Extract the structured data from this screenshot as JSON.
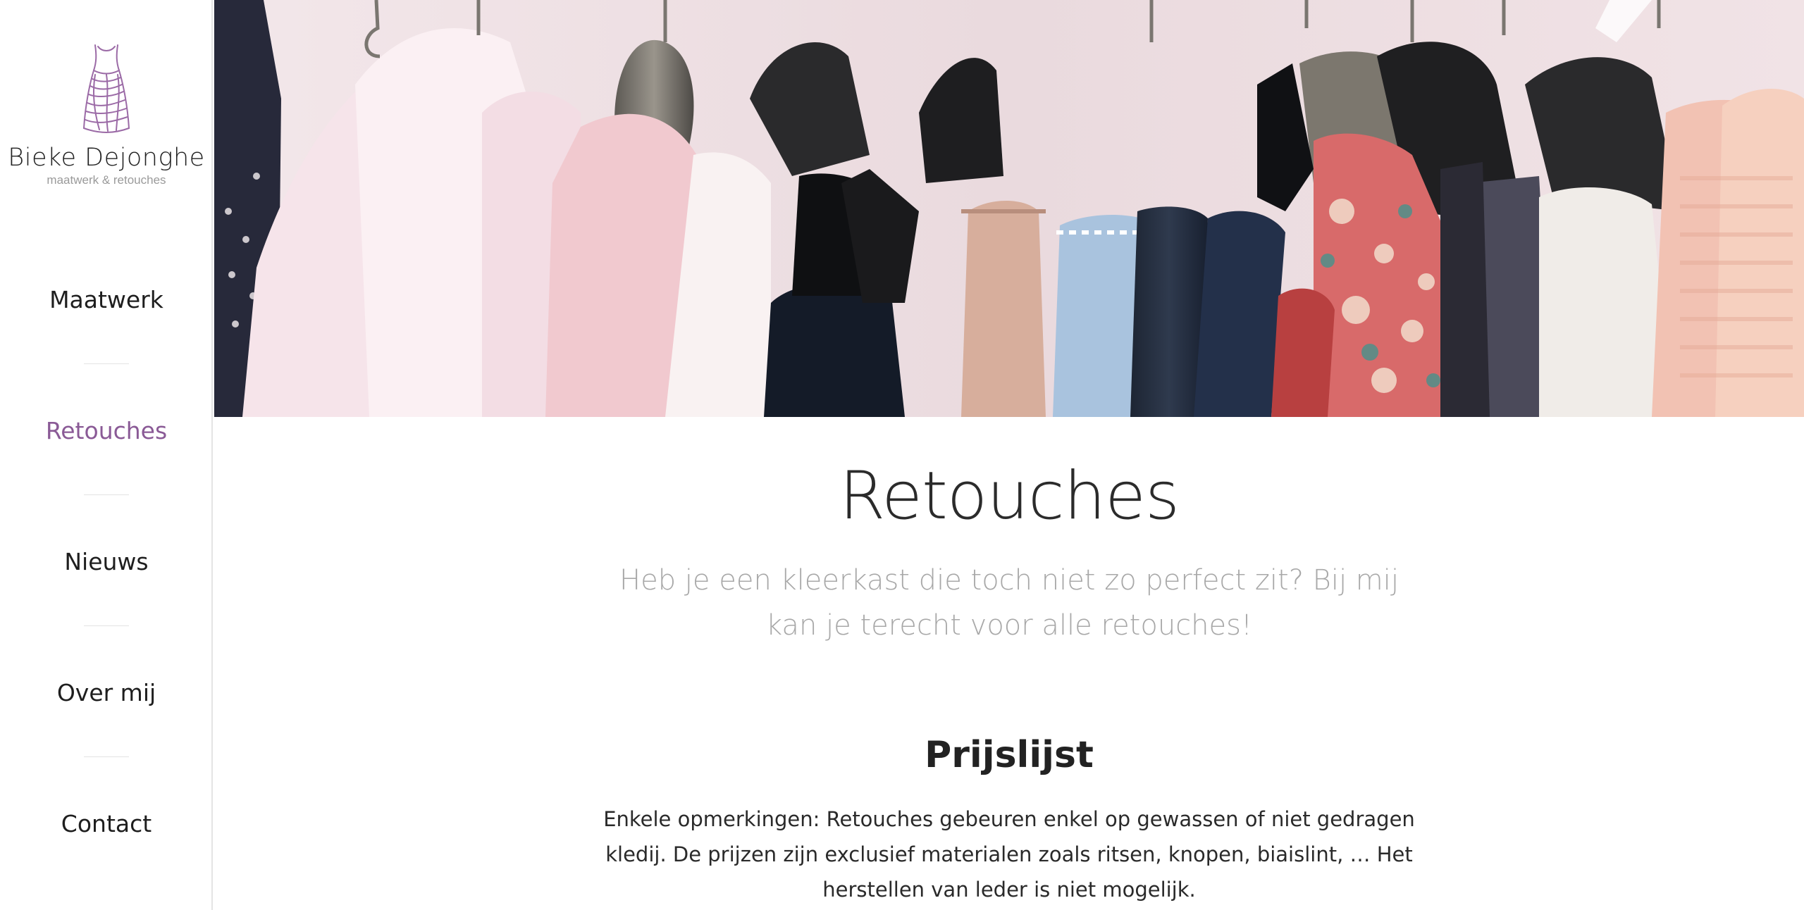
{
  "brand": {
    "name": "Bieke Dejonghe",
    "tagline": "maatwerk & retouches",
    "accent_color": "#8a5a96",
    "logo_icon": "dress-icon"
  },
  "nav": {
    "items": [
      {
        "label": "Maatwerk",
        "active": false
      },
      {
        "label": "Retouches",
        "active": true
      },
      {
        "label": "Nieuws",
        "active": false
      },
      {
        "label": "Over mij",
        "active": false
      },
      {
        "label": "Contact",
        "active": false
      }
    ]
  },
  "hero": {
    "image_subject": "clothes-on-hangers"
  },
  "main": {
    "title": "Retouches",
    "intro": "Heb je een kleerkast die toch niet zo perfect zit? Bij mij kan je terecht voor alle retouches!",
    "section_title": "Prijslijst",
    "section_text": "Enkele opmerkingen: Retouches gebeuren enkel op gewassen of niet gedragen kledij. De prijzen zijn exclusief materialen zoals ritsen, knopen, biaislint, … Het herstellen van leder is niet mogelijk."
  }
}
